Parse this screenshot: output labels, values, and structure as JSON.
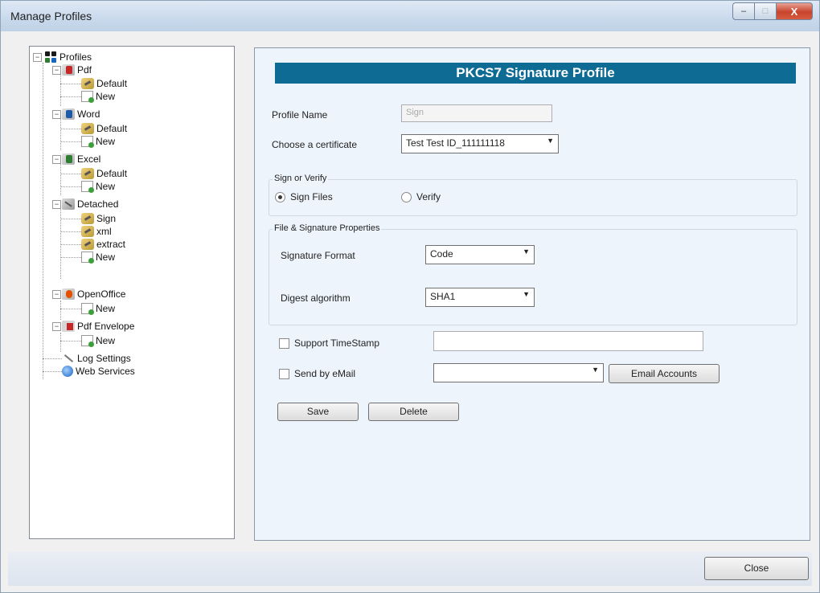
{
  "window": {
    "title": "Manage Profiles",
    "close_glyph": "X",
    "min_glyph": "–",
    "max_glyph": "□"
  },
  "tree": {
    "root": "Profiles",
    "pdf": "Pdf",
    "pdf_default": "Default",
    "pdf_new": "New",
    "word": "Word",
    "word_default": "Default",
    "word_new": "New",
    "excel": "Excel",
    "excel_default": "Default",
    "excel_new": "New",
    "detached": "Detached",
    "det_sign": "Sign",
    "det_xml": "xml",
    "det_extract": "extract",
    "det_new": "New",
    "oo": "OpenOffice",
    "oo_new": "New",
    "env": "Pdf Envelope",
    "env_new": "New",
    "logs": "Log Settings",
    "web": "Web Services",
    "expander_glyph": "−"
  },
  "panel": {
    "title": "PKCS7 Signature Profile",
    "profile_name_label": "Profile Name",
    "profile_name_value": "Sign",
    "cert_label": "Choose a certificate",
    "cert_value": "Test Test ID_111111118",
    "sign_group": "Sign or Verify",
    "sign_files": "Sign Files",
    "verify": "Verify",
    "props_group": "File & Signature Properties",
    "sig_format_label": "Signature Format",
    "sig_format_value": "Code",
    "digest_label": "Digest algorithm",
    "digest_value": "SHA1",
    "timestamp_label": "Support TimeStamp",
    "timestamp_value": "",
    "email_label": "Send by eMail",
    "email_value": "",
    "email_accounts_btn": "Email Accounts",
    "save_btn": "Save",
    "delete_btn": "Delete",
    "arrow_glyph": "▼"
  },
  "footer": {
    "close_btn": "Close"
  },
  "colors": {
    "banner": "#0d6b94",
    "panel_bg": "#eef4fb"
  }
}
